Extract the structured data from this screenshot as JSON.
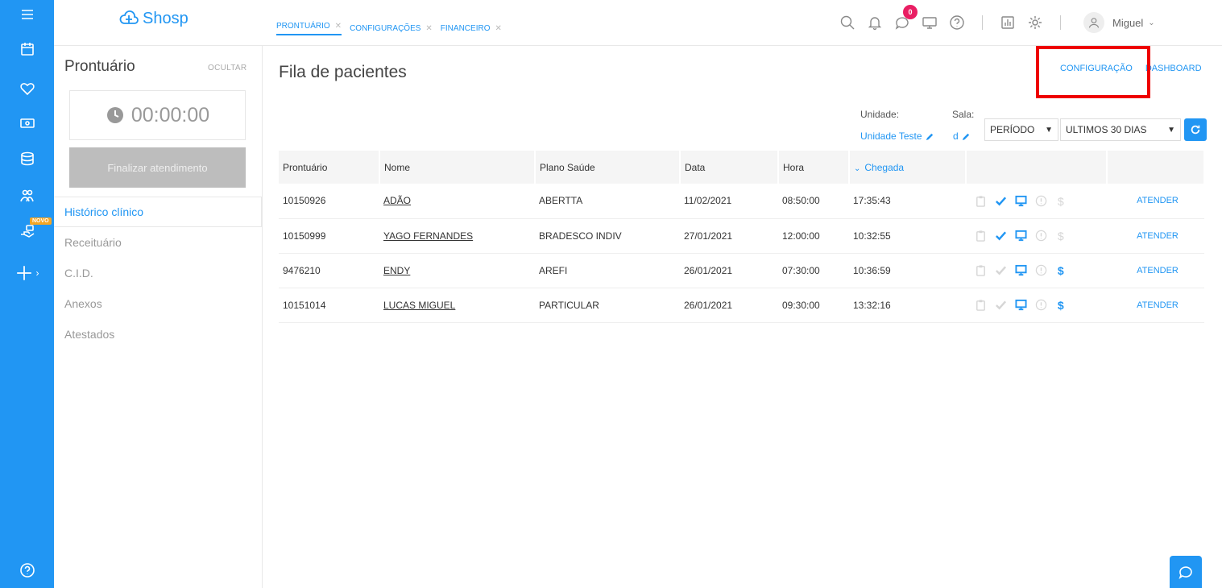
{
  "brand": {
    "name": "Shosp",
    "accent": "#2196f3",
    "highlight": "#e00000"
  },
  "rail": {
    "new_badge": "NOVO"
  },
  "tabs": [
    {
      "label": "PRONTUÁRIO"
    },
    {
      "label": "CONFIGURAÇÕES"
    },
    {
      "label": "FINANCEIRO"
    }
  ],
  "topbar": {
    "notifications_count": "0",
    "user_name": "Miguel"
  },
  "sidebar": {
    "title": "Prontuário",
    "hide_label": "OCULTAR",
    "timer": "00:00:00",
    "finish_label": "Finalizar atendimento",
    "items": [
      {
        "label": "Histórico clínico"
      },
      {
        "label": "Receituário"
      },
      {
        "label": "C.I.D."
      },
      {
        "label": "Anexos"
      },
      {
        "label": "Atestados"
      }
    ]
  },
  "main": {
    "title": "Fila de pacientes",
    "config_link": "CONFIGURAÇÃO",
    "dashboard_link": "DASHBOARD",
    "filters": {
      "unit_label": "Unidade:",
      "unit_value": "Unidade Teste",
      "room_label": "Sala:",
      "room_value": "d",
      "period_select": "PERÍODO",
      "range_select": "ULTIMOS 30 DIAS"
    },
    "columns": [
      "Prontuário",
      "Nome",
      "Plano Saúde",
      "Data",
      "Hora",
      "Chegada"
    ],
    "action_label": "ATENDER",
    "rows": [
      {
        "id": "10150926",
        "name": "ADÃO",
        "plan": "ABERTTA",
        "date": "11/02/2021",
        "time": "08:50:00",
        "arrival": "17:35:43",
        "checked": true,
        "paid": false
      },
      {
        "id": "10150999",
        "name": "YAGO FERNANDES",
        "plan": "BRADESCO INDIV",
        "date": "27/01/2021",
        "time": "12:00:00",
        "arrival": "10:32:55",
        "checked": true,
        "paid": false
      },
      {
        "id": "9476210",
        "name": "ENDY",
        "plan": "AREFI",
        "date": "26/01/2021",
        "time": "07:30:00",
        "arrival": "10:36:59",
        "checked": false,
        "paid": true
      },
      {
        "id": "10151014",
        "name": "LUCAS MIGUEL",
        "plan": "PARTICULAR",
        "date": "26/01/2021",
        "time": "09:30:00",
        "arrival": "13:32:16",
        "checked": false,
        "paid": true
      }
    ]
  }
}
